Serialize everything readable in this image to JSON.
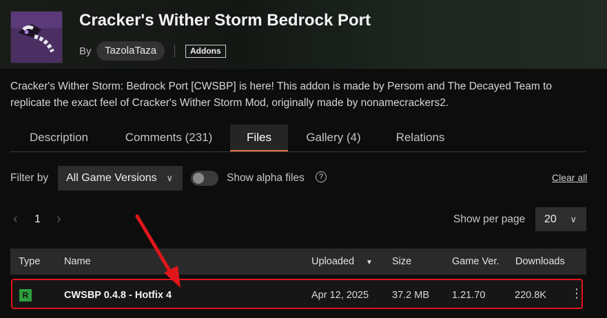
{
  "project": {
    "title": "Cracker's Wither Storm Bedrock Port",
    "by_label": "By",
    "author": "TazolaTaza",
    "category": "Addons",
    "description": "Cracker's Wither Storm: Bedrock Port [CWSBP] is here! This addon is made by Persom and The Decayed Team to replicate the exact feel of Cracker's Wither Storm Mod, originally made by nonamecrackers2."
  },
  "tabs": [
    {
      "label": "Description"
    },
    {
      "label": "Comments (231)"
    },
    {
      "label": "Files",
      "active": true
    },
    {
      "label": "Gallery (4)"
    },
    {
      "label": "Relations"
    }
  ],
  "filters": {
    "filter_label": "Filter by",
    "version_select": "All Game Versions",
    "alpha_toggle_label": "Show alpha files",
    "help_glyph": "?",
    "clear_all": "Clear all"
  },
  "pagination": {
    "current_page": "1",
    "per_page_label": "Show per page",
    "per_page_value": "20"
  },
  "table": {
    "headers": {
      "type": "Type",
      "name": "Name",
      "uploaded": "Uploaded",
      "size": "Size",
      "game_ver": "Game Ver.",
      "downloads": "Downloads"
    },
    "rows": [
      {
        "type_badge": "R",
        "name": "CWSBP 0.4.8 - Hotfix 4",
        "uploaded": "Apr 12, 2025",
        "size": "37.2 MB",
        "game_ver": "1.21.70",
        "downloads": "220.8K"
      }
    ]
  },
  "colors": {
    "accent_tab_underline": "#e8734a",
    "highlight_border": "#e0161b",
    "release_badge": "#2e9e3e"
  },
  "icons": {
    "select_chevron": "chevron-down-icon",
    "sort_arrow": "sort-down-icon",
    "prev": "chevron-left-icon",
    "next": "chevron-right-icon",
    "row_menu": "kebab-menu-icon",
    "help": "help-circle-icon"
  }
}
